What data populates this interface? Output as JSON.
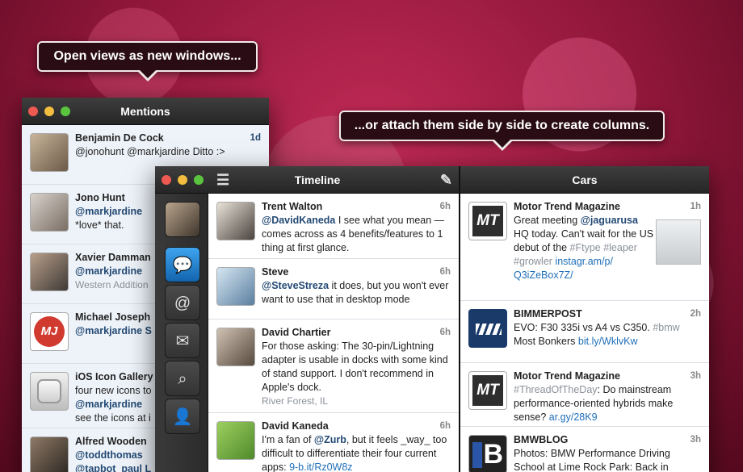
{
  "callouts": {
    "left": "Open views as new windows...",
    "right": "...or attach them side by side to create columns."
  },
  "mentions": {
    "title": "Mentions",
    "tweets": [
      {
        "name": "Benjamin De Cock",
        "time": "1d",
        "lines": [
          "@jonohunt @markjardine Ditto :>"
        ]
      },
      {
        "name": "Jono Hunt",
        "time": "",
        "lines": [
          "@markjardine",
          "*love* that."
        ]
      },
      {
        "name": "Xavier Damman",
        "time": "",
        "lines": [
          "@markjardine",
          "Western Addition"
        ]
      },
      {
        "name": "Michael Joseph",
        "time": "",
        "lines": [
          "@markjardine S"
        ]
      },
      {
        "name": "iOS Icon Gallery",
        "time": "",
        "lines": [
          "four new icons to",
          "@markjardine",
          "see the icons at i"
        ]
      },
      {
        "name": "Alfred Wooden",
        "time": "",
        "lines": [
          "@toddthomas",
          "@tapbot_paul L"
        ]
      }
    ],
    "avatars": [
      "face-icon",
      "face-icon",
      "face-icon",
      "mj-logo",
      "ios-app-icon",
      "face-icon"
    ],
    "mj_logo": "MJ"
  },
  "timeline": {
    "title": "Timeline",
    "tweets": [
      {
        "name": "Trent Walton",
        "time": "6h",
        "mention": "@DavidKaneda",
        "text": " I see what you mean —comes across as 4 benefits/features to 1 thing at first glance."
      },
      {
        "name": "Steve",
        "time": "6h",
        "mention": "@SteveStreza",
        "text": " it does, but you won't ever want to use that in desktop mode"
      },
      {
        "name": "David Chartier",
        "time": "6h",
        "text": "For those asking: The 30-pin/Lightning adapter is usable in docks with some kind of stand support. I don't recommend in Apple's dock.",
        "location": "River Forest, IL"
      },
      {
        "name": "David Kaneda",
        "time": "6h",
        "pre": "I'm a fan of ",
        "mention": "@Zurb",
        "text": ", but it feels _way_ too difficult to differentiate their four current apps: ",
        "link": "9-b.it/Rz0W8z"
      }
    ],
    "sidebar": [
      "avatar",
      "chat-bubble-icon",
      "at-sign-icon",
      "envelope-icon",
      "search-icon",
      "profile-icon"
    ]
  },
  "cars": {
    "title": "Cars",
    "tweets": [
      {
        "name": "Motor Trend Magazine",
        "time": "1h",
        "logo": "MT"
      },
      {
        "name": "BIMMERPOST",
        "time": "2h"
      },
      {
        "name": "Motor Trend Magazine",
        "time": "3h",
        "logo": "MT"
      },
      {
        "name": "BMWBLOG",
        "time": "3h",
        "logo": "B"
      }
    ],
    "t1": {
      "a": "Great meeting ",
      "m": "@jaguarusa",
      "b": " HQ today. Can't wait for the US debut of the ",
      "h1": "#Ftype",
      "h2": " #leaper",
      "h3": "#growler",
      "l1": " instagr.am/p/",
      "l2": "Q3iZeBox7Z/"
    },
    "t2": {
      "a": "EVO: F30 335i vs A4 vs C350. ",
      "h": "#bmw",
      "b": " Most Bonkers ",
      "l": "bit.ly/WklvKw"
    },
    "t3": {
      "h": "#ThreadOfTheDay",
      "a": ": Do mainstream performance-oriented hybrids make sense? ",
      "l": "ar.gy/28K9"
    },
    "t4": {
      "a": "Photos: BMW Performance Driving School at Lime Rock Park: Back in"
    }
  },
  "colors": {
    "accent": "#1f6eb8",
    "mention": "#244a74",
    "window_chrome": "#2e2e2e"
  }
}
